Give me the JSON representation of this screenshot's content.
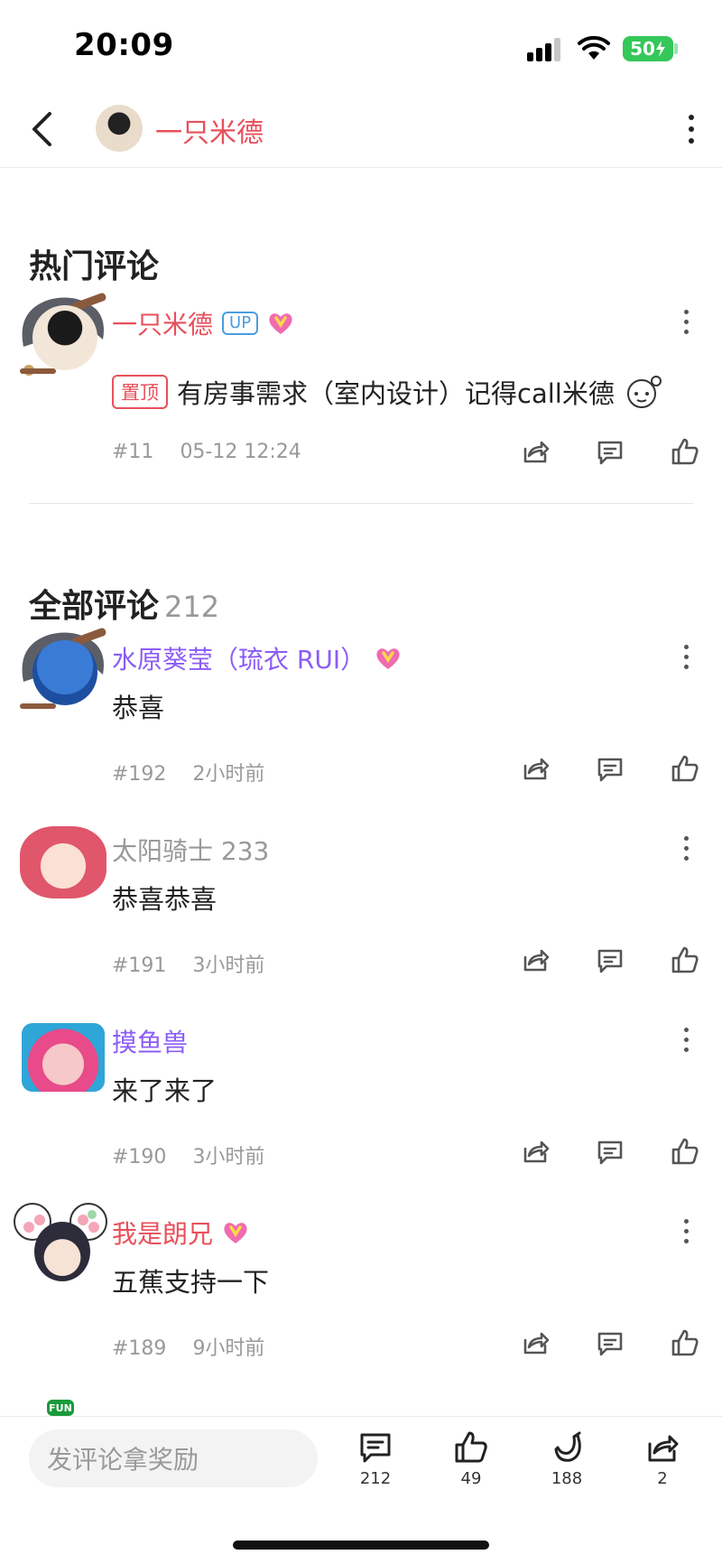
{
  "status_bar": {
    "time": "20:09",
    "battery": "50"
  },
  "header": {
    "username": "一只米德"
  },
  "hot_section": {
    "title": "热门评论",
    "comment": {
      "name": "一只米德",
      "name_color": "#e8505b",
      "up_badge": "UP",
      "pin_badge": "置顶",
      "text": "有房事需求（室内设计）记得call米德",
      "floor": "#11",
      "time": "05-12 12:24"
    }
  },
  "all_section": {
    "title": "全部评论",
    "count": "212",
    "comments": [
      {
        "name": "水原葵莹（琉衣 RUI）",
        "name_color": "#8b5cf6",
        "text": "恭喜",
        "floor": "#192",
        "time": "2小时前",
        "vip": true
      },
      {
        "name": "太阳骑士 233",
        "name_color": "#999999",
        "text": "恭喜恭喜",
        "floor": "#191",
        "time": "3小时前",
        "vip": false
      },
      {
        "name": "摸鱼兽",
        "name_color": "#8b5cf6",
        "text": "来了来了",
        "floor": "#190",
        "time": "3小时前",
        "vip": false
      },
      {
        "name": "我是朗兄",
        "name_color": "#e8505b",
        "text": "五蕉支持一下",
        "floor": "#189",
        "time": "9小时前",
        "vip": true
      }
    ]
  },
  "bottom_bar": {
    "fun_tag": "FUN",
    "input_placeholder": "发评论拿奖励",
    "comments_count": "212",
    "likes_count": "49",
    "bananas_count": "188",
    "shares_count": "2"
  },
  "icons": [
    "back-icon",
    "more-icon",
    "share-icon",
    "reply-icon",
    "like-icon",
    "banana-icon",
    "vip-icon"
  ]
}
